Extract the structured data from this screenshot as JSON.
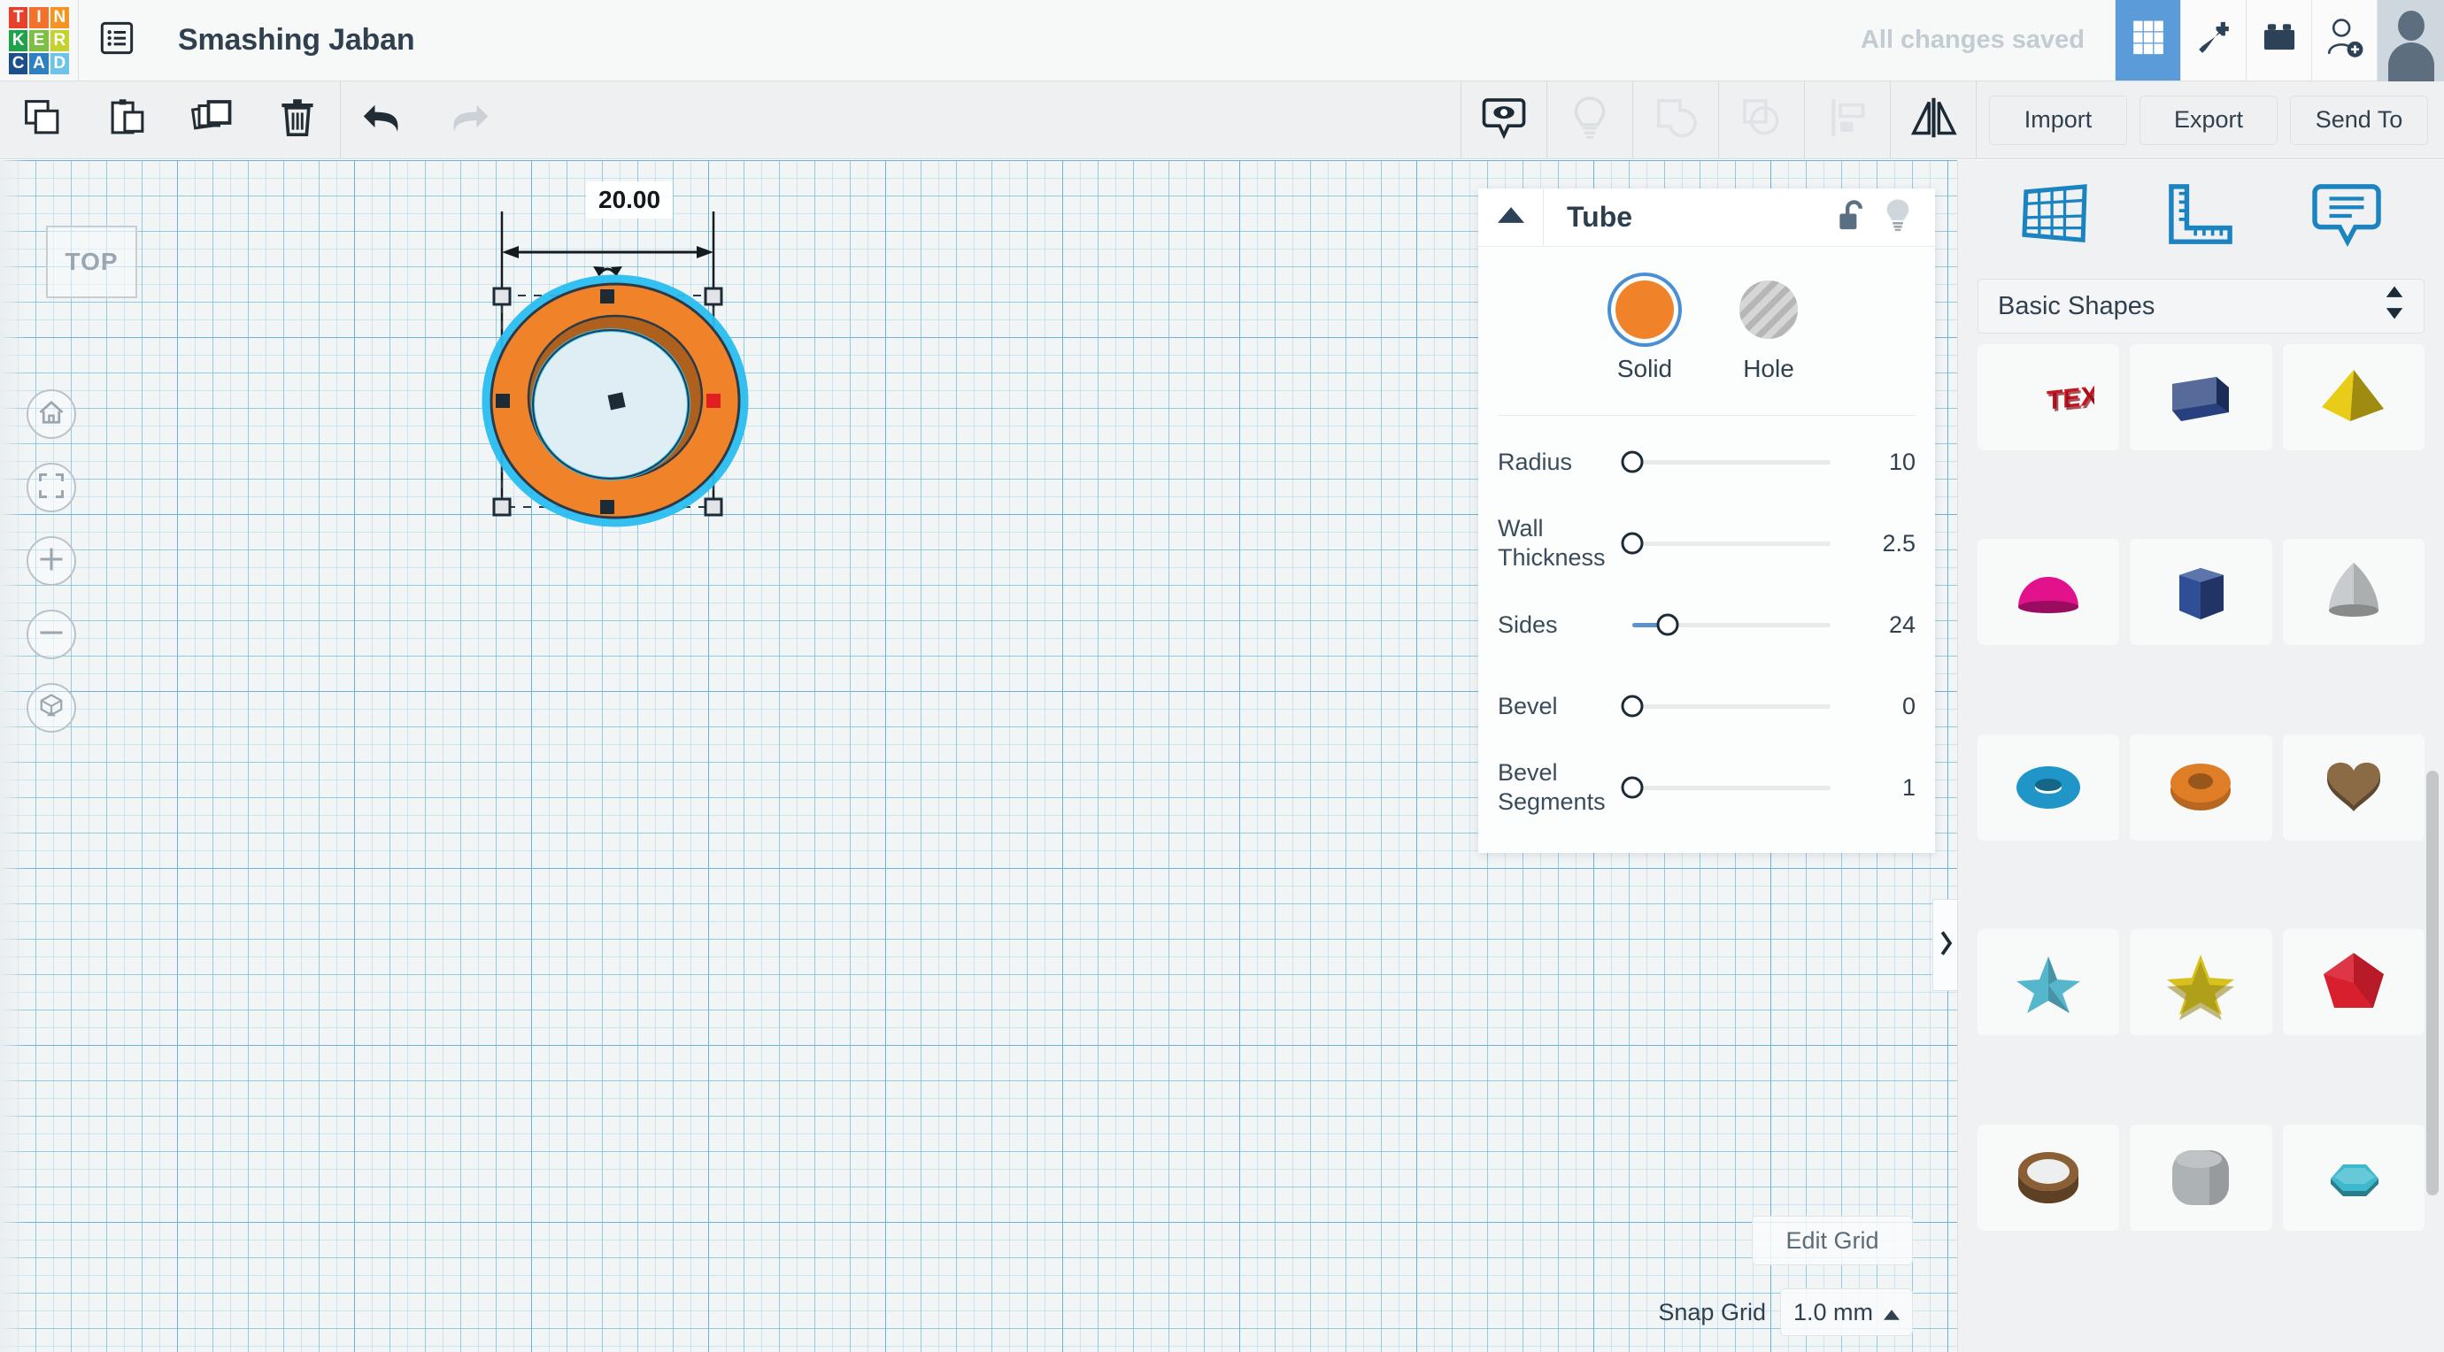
{
  "app": {
    "logo_letters": [
      "T",
      "I",
      "N",
      "K",
      "E",
      "R",
      "C",
      "A",
      "D"
    ],
    "logo_colors": [
      "#e8402a",
      "#f2722b",
      "#f79421",
      "#1fa34a",
      "#7cc043",
      "#c4d22e",
      "#1a4f8c",
      "#2e80c2",
      "#6dc4e8"
    ],
    "design_title": "Smashing Jaban",
    "save_status": "All changes saved",
    "menu_icon": "list-menu-icon",
    "header_tool_icons": [
      "grid-view-icon",
      "minecraft-pickaxe-icon",
      "lego-brick-icon",
      "invite-person-icon"
    ],
    "avatar": "user-avatar"
  },
  "toolbar": {
    "left_tools": [
      {
        "name": "copy-button",
        "icon": "copy-icon",
        "enabled": true
      },
      {
        "name": "paste-button",
        "icon": "paste-icon",
        "enabled": true
      },
      {
        "name": "duplicate-button",
        "icon": "duplicate-icon",
        "enabled": true
      },
      {
        "name": "delete-button",
        "icon": "trash-icon",
        "enabled": true
      },
      {
        "name": "undo-button",
        "icon": "undo-arrow-icon",
        "enabled": true
      },
      {
        "name": "redo-button",
        "icon": "redo-arrow-icon",
        "enabled": false
      }
    ],
    "center_tools": [
      {
        "name": "show-hide-button",
        "icon": "eye-callout-icon",
        "enabled": true
      },
      {
        "name": "highlight-button",
        "icon": "lightbulb-icon",
        "enabled": false
      },
      {
        "name": "group-button",
        "icon": "group-shapes-icon",
        "enabled": false
      },
      {
        "name": "ungroup-button",
        "icon": "ungroup-shapes-icon",
        "enabled": false
      },
      {
        "name": "align-button",
        "icon": "align-icon",
        "enabled": false
      },
      {
        "name": "mirror-button",
        "icon": "mirror-flip-icon",
        "enabled": true
      }
    ],
    "import_label": "Import",
    "export_label": "Export",
    "send_to_label": "Send To"
  },
  "canvas": {
    "view_cube_label": "TOP",
    "nav_buttons": [
      {
        "name": "home-view-button",
        "icon": "home-icon"
      },
      {
        "name": "fit-to-view-button",
        "icon": "fit-frame-icon"
      },
      {
        "name": "zoom-in-button",
        "icon": "plus-icon"
      },
      {
        "name": "zoom-out-button",
        "icon": "minus-icon"
      },
      {
        "name": "ortho-perspective-button",
        "icon": "cube-arrow-icon"
      }
    ],
    "dimension_label": "20.00",
    "edit_grid_label": "Edit Grid",
    "snap_grid_label": "Snap Grid",
    "snap_grid_value": "1.0 mm",
    "collapse_icon": "chevron-right-icon",
    "object": {
      "type": "tube",
      "fill_color": "#f0832a",
      "inner_wall_color": "#b0601d",
      "outline_color": "#2b3a46",
      "selection_glow": "#29bdf0",
      "hole_fill": "#dfeef5"
    }
  },
  "properties_panel": {
    "title": "Tube",
    "collapse_icon": "triangle-up-icon",
    "lock_icon": "unlocked-padlock-icon",
    "light_icon": "lightbulb-icon",
    "solid_label": "Solid",
    "hole_label": "Hole",
    "selected_mode": "Solid",
    "solid_color": "#f0832a",
    "selected_ring_color": "#4a8fd4",
    "sliders": [
      {
        "label": "Radius",
        "value": "10",
        "pct": 0,
        "filled": false
      },
      {
        "label": "Wall Thickness",
        "value": "2.5",
        "pct": 0,
        "filled": false
      },
      {
        "label": "Sides",
        "value": "24",
        "pct": 20,
        "filled": true
      },
      {
        "label": "Bevel",
        "value": "0",
        "pct": 0,
        "filled": false
      },
      {
        "label": "Bevel Segments",
        "value": "1",
        "pct": 0,
        "filled": false
      }
    ]
  },
  "sidebar": {
    "tool_icons": [
      {
        "name": "workplane-icon",
        "color": "#1b84c0"
      },
      {
        "name": "ruler-icon",
        "color": "#1b84c0"
      },
      {
        "name": "note-callout-icon",
        "color": "#1b84c0"
      }
    ],
    "category_label": "Basic Shapes",
    "category_caret": "updown-caret-icon",
    "shapes": [
      {
        "name": "shape-text",
        "label": "Text",
        "color": "#cc1420",
        "kind": "text"
      },
      {
        "name": "shape-box",
        "label": "Box",
        "color": "#28417e",
        "kind": "box"
      },
      {
        "name": "shape-pyramid",
        "label": "Pyramid",
        "color": "#e8cc18",
        "kind": "pyramid"
      },
      {
        "name": "shape-half-sphere",
        "label": "Half Sphere",
        "color": "#e2128c",
        "kind": "dome"
      },
      {
        "name": "shape-hexagonal-prism",
        "label": "Hexagonal Prism",
        "color": "#2f4e96",
        "kind": "prism"
      },
      {
        "name": "shape-cone",
        "label": "Cone",
        "color": "#c8ccce",
        "kind": "cone"
      },
      {
        "name": "shape-torus",
        "label": "Torus",
        "color": "#1f96c7",
        "kind": "torus"
      },
      {
        "name": "shape-tube",
        "label": "Tube",
        "color": "#e07e27",
        "kind": "tube"
      },
      {
        "name": "shape-heart",
        "label": "Heart",
        "color": "#8a6b46",
        "kind": "heart"
      },
      {
        "name": "shape-star-3d",
        "label": "3D Star",
        "color": "#56b6cc",
        "kind": "star3d"
      },
      {
        "name": "shape-star",
        "label": "Star",
        "color": "#d6c11e",
        "kind": "star"
      },
      {
        "name": "shape-polygon",
        "label": "Polygon",
        "color": "#d81f2e",
        "kind": "polyhedron"
      },
      {
        "name": "shape-ring",
        "label": "Ring",
        "color": "#8a5f35",
        "kind": "ring"
      },
      {
        "name": "shape-rounded-cube",
        "label": "Rounded Cube",
        "color": "#adb2b5",
        "kind": "roundcube"
      },
      {
        "name": "shape-gem",
        "label": "Gem",
        "color": "#3cb9cd",
        "kind": "gem"
      }
    ]
  }
}
